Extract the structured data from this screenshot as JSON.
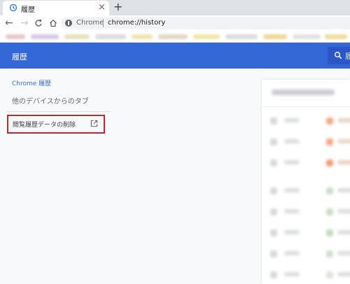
{
  "browser": {
    "tab": {
      "title": "履歴",
      "icon": "history-icon",
      "close": "×"
    },
    "new_tab": "+",
    "nav": {
      "back": "←",
      "forward": "→",
      "reload": "C",
      "home": "⌂"
    },
    "omnibox": {
      "site_name": "Chrome",
      "url": "chrome://history"
    }
  },
  "header": {
    "title": "履歴",
    "search_partial": "履"
  },
  "sidebar": {
    "chrome_history": "Chrome 履歴",
    "other_devices": "他のデバイスからのタブ",
    "clear_browsing_data": "閲覧履歴データの削除"
  },
  "colors": {
    "header_blue": "#3367d6",
    "highlight_red": "#c62828",
    "favicon_orange": "#f4a582"
  }
}
